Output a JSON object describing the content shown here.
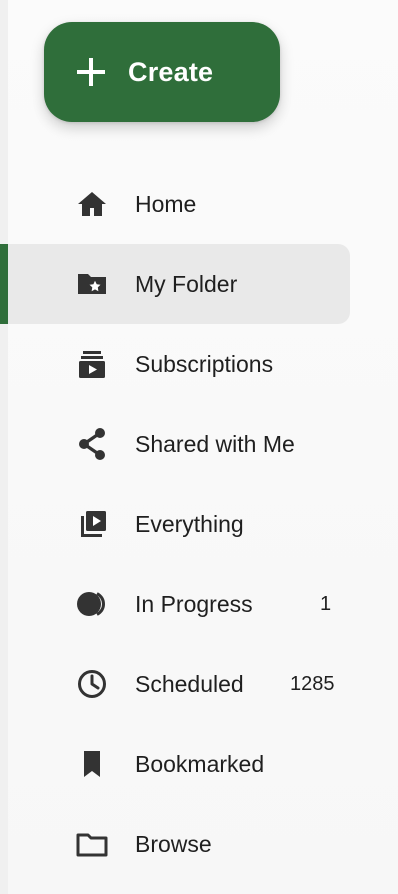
{
  "create_button": {
    "label": "Create",
    "icon": "plus-icon",
    "color": "#2f6e3a"
  },
  "nav": {
    "items": [
      {
        "label": "Home",
        "icon": "home-icon",
        "active": false,
        "count": ""
      },
      {
        "label": "My Folder",
        "icon": "folder-star-icon",
        "active": true,
        "count": ""
      },
      {
        "label": "Subscriptions",
        "icon": "subscriptions-icon",
        "active": false,
        "count": ""
      },
      {
        "label": "Shared with Me",
        "icon": "share-icon",
        "active": false,
        "count": ""
      },
      {
        "label": "Everything",
        "icon": "video-library-icon",
        "active": false,
        "count": ""
      },
      {
        "label": "In Progress",
        "icon": "in-progress-icon",
        "active": false,
        "count": "1"
      },
      {
        "label": "Scheduled",
        "icon": "clock-icon",
        "active": false,
        "count": "1285"
      },
      {
        "label": "Bookmarked",
        "icon": "bookmark-icon",
        "active": false,
        "count": ""
      },
      {
        "label": "Browse",
        "icon": "folder-icon",
        "active": false,
        "count": ""
      }
    ]
  },
  "theme": {
    "accent": "#2f6e3a",
    "active_background": "#e9e9e9",
    "text": "#1f1f1f",
    "icon": "#333333"
  }
}
